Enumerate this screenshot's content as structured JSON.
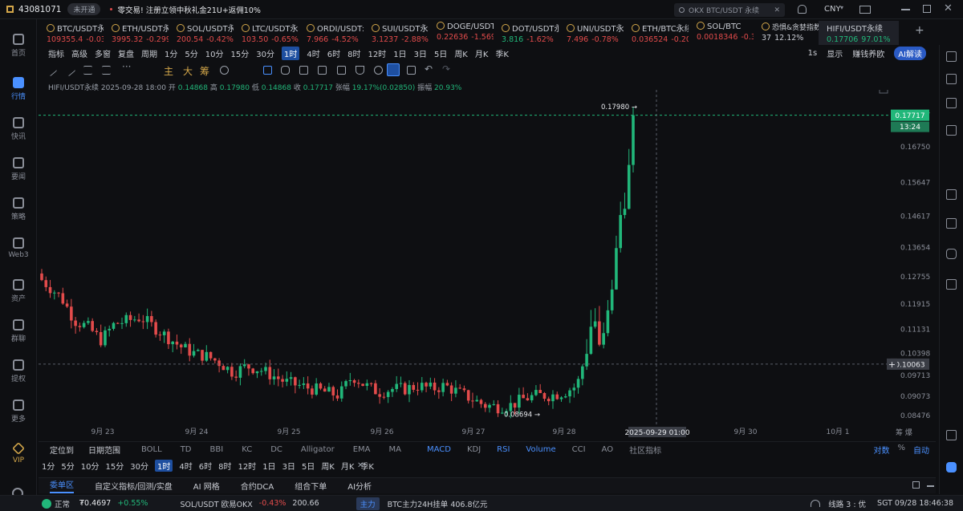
{
  "topbar": {
    "account_id": "43081071",
    "badge": "未开通",
    "promo": "零交易! 注册立领中秋礼金21U+返佣10%",
    "search_placeholder": "OKX BTC/USDT 永续",
    "currency": "CNY"
  },
  "sidebar": [
    {
      "label": "首页"
    },
    {
      "label": "行情"
    },
    {
      "label": "快讯"
    },
    {
      "label": "要闻"
    },
    {
      "label": "策略"
    },
    {
      "label": "Web3"
    },
    {
      "label": "资产"
    },
    {
      "label": "群聊"
    },
    {
      "label": "提权"
    },
    {
      "label": "更多"
    },
    {
      "label": "VIP"
    }
  ],
  "tickers": [
    {
      "name": "BTC/USDT永续",
      "price": "109355.4",
      "change": "-0.03",
      "dir": "dn"
    },
    {
      "name": "ETH/USDT永",
      "price": "3995.32",
      "change": "-0.299",
      "dir": "dn"
    },
    {
      "name": "SOL/USDT永",
      "price": "200.54",
      "change": "-0.42%",
      "dir": "dn"
    },
    {
      "name": "LTC/USDT永续",
      "price": "103.50",
      "change": "-0.65%",
      "dir": "dn"
    },
    {
      "name": "ORDI/USDT永",
      "price": "7.966",
      "change": "-4.52%",
      "dir": "dn"
    },
    {
      "name": "SUI/USDT永续",
      "price": "3.1237",
      "change": "-2.88%",
      "dir": "dn"
    },
    {
      "name": "DOGE/USDT",
      "price": "0.22636",
      "change": "-1.569",
      "dir": "dn"
    },
    {
      "name": "DOT/USDT永",
      "price": "3.816",
      "change": "-1.62%",
      "dir": "up"
    },
    {
      "name": "UNI/USDT永",
      "price": "7.496",
      "change": "-0.78%",
      "dir": "dn"
    },
    {
      "name": "ETH/BTC永续",
      "price": "0.036524",
      "change": "-0.20",
      "dir": "dn"
    },
    {
      "name": "SOL/BTC",
      "price": "0.0018346",
      "change": "-0.3",
      "dir": "dn"
    },
    {
      "name": "恐惧&贪婪指数",
      "price": "37",
      "change": "12.12%",
      "dir": "plain"
    },
    {
      "name": "HIFI/USDT永续",
      "price": "0.17706",
      "change": "97.01%",
      "dir": "up",
      "selected": true
    }
  ],
  "toolbar": {
    "items": [
      "指标",
      "高级",
      "多窗",
      "复盘",
      "周期",
      "1分",
      "5分",
      "10分",
      "15分",
      "30分",
      "1时",
      "4时",
      "6时",
      "8时",
      "12时",
      "1日",
      "3日",
      "5日",
      "周K",
      "月K",
      "季K"
    ],
    "active": "1时",
    "right_items": [
      "1s",
      "显示",
      "赚钱养欧",
      "AI解读"
    ]
  },
  "chart_toolbar": {
    "labels": [
      "主",
      "大",
      "筹"
    ]
  },
  "ohlc": {
    "symbol": "HIFI/USDT永续",
    "time": "2025-09-28 18:00",
    "open_label": "开",
    "open": "0.14868",
    "high_label": "高",
    "high": "0.17980",
    "low_label": "低",
    "low": "0.14868",
    "close_label": "收",
    "close": "0.17717",
    "change_label": "张幅",
    "change": "19.17%(0.02850)",
    "amp_label": "振幅",
    "amp": "20.93%"
  },
  "chart_data": {
    "type": "candlestick",
    "x_labels": [
      "9月 23",
      "9月 24",
      "9月 25",
      "9月 26",
      "9月 27",
      "9月 28",
      "9月 30",
      "10月 1"
    ],
    "y_ticks": [
      "0.17717",
      "0.16750",
      "0.15647",
      "0.14617",
      "0.13654",
      "0.12755",
      "0.11915",
      "0.11131",
      "0.10398",
      "0.09713",
      "0.09073",
      "0.08476"
    ],
    "y_values": [
      0.17717,
      0.1675,
      0.15647,
      0.14617,
      0.13654,
      0.12755,
      0.11915,
      0.11131,
      0.10398,
      0.09713,
      0.09073,
      0.08476
    ],
    "ylim": [
      0.08235,
      0.183
    ],
    "crosshair": {
      "price": "0.10063",
      "time": "2025-09-29 01:00"
    },
    "current_price": "0.17717",
    "countdown": "13:24",
    "max_label": "0.17980",
    "min_label": "0.08694",
    "candles_count": 141,
    "close_path": [
      [
        0,
        0.1265
      ],
      [
        6,
        0.121
      ],
      [
        10,
        0.114
      ],
      [
        14,
        0.112
      ],
      [
        18,
        0.108
      ],
      [
        22,
        0.113
      ],
      [
        26,
        0.114
      ],
      [
        30,
        0.115
      ],
      [
        34,
        0.112
      ],
      [
        38,
        0.109
      ],
      [
        42,
        0.106
      ],
      [
        46,
        0.104
      ],
      [
        50,
        0.103
      ],
      [
        54,
        0.101
      ],
      [
        58,
        0.098
      ],
      [
        62,
        0.1
      ],
      [
        66,
        0.099
      ],
      [
        70,
        0.097
      ],
      [
        74,
        0.095
      ],
      [
        78,
        0.094
      ],
      [
        82,
        0.093
      ],
      [
        86,
        0.092
      ],
      [
        90,
        0.091
      ],
      [
        94,
        0.097
      ],
      [
        98,
        0.094
      ],
      [
        102,
        0.092
      ],
      [
        106,
        0.093
      ],
      [
        110,
        0.093
      ],
      [
        114,
        0.094
      ],
      [
        118,
        0.093
      ],
      [
        122,
        0.094
      ],
      [
        126,
        0.092
      ],
      [
        130,
        0.09
      ],
      [
        134,
        0.088
      ],
      [
        138,
        0.0875
      ],
      [
        142,
        0.088
      ],
      [
        146,
        0.09
      ],
      [
        150,
        0.091
      ],
      [
        154,
        0.091
      ],
      [
        158,
        0.092
      ],
      [
        162,
        0.094
      ],
      [
        165,
        0.105
      ],
      [
        167,
        0.117
      ],
      [
        169,
        0.104
      ],
      [
        171,
        0.114
      ],
      [
        173,
        0.127
      ],
      [
        175,
        0.146
      ],
      [
        177,
        0.152
      ],
      [
        179,
        0.17717
      ]
    ]
  },
  "indicators": {
    "left": [
      "定位到",
      "日期范围"
    ],
    "main": [
      "BOLL",
      "TD",
      "BBI",
      "KC",
      "DC",
      "Alligator",
      "EMA",
      "MA"
    ],
    "sub": [
      "MACD",
      "KDJ",
      "RSI",
      "Volume",
      "CCI",
      "AO",
      "社区指标"
    ],
    "right": [
      "对数",
      "%",
      "自动"
    ]
  },
  "periods": {
    "items": [
      "1分",
      "5分",
      "10分",
      "15分",
      "30分",
      "1时",
      "4时",
      "6时",
      "8时",
      "12时",
      "1日",
      "3日",
      "5日",
      "周K",
      "月K",
      "季K"
    ],
    "active": "1时"
  },
  "bottom_tabs": [
    "委单区",
    "自定义指标/回测/实盘",
    "AI 网格",
    "合约DCA",
    "组合下单",
    "AI分析"
  ],
  "status": {
    "state": "正常",
    "price": "₮0.4697",
    "change": "+0.55%",
    "pair": "SOL/USDT 欧易OKX",
    "pair_change": "-0.43%",
    "pair_price": "200.66",
    "tag": "主力",
    "news": "BTC主力24H挂单 406.8亿元",
    "line": "线路 3 : 优",
    "time": "SGT 09/28 18:46:38"
  },
  "colors": {
    "up": "#21b77a",
    "down": "#e24b4b",
    "accent": "#4a90ff"
  }
}
